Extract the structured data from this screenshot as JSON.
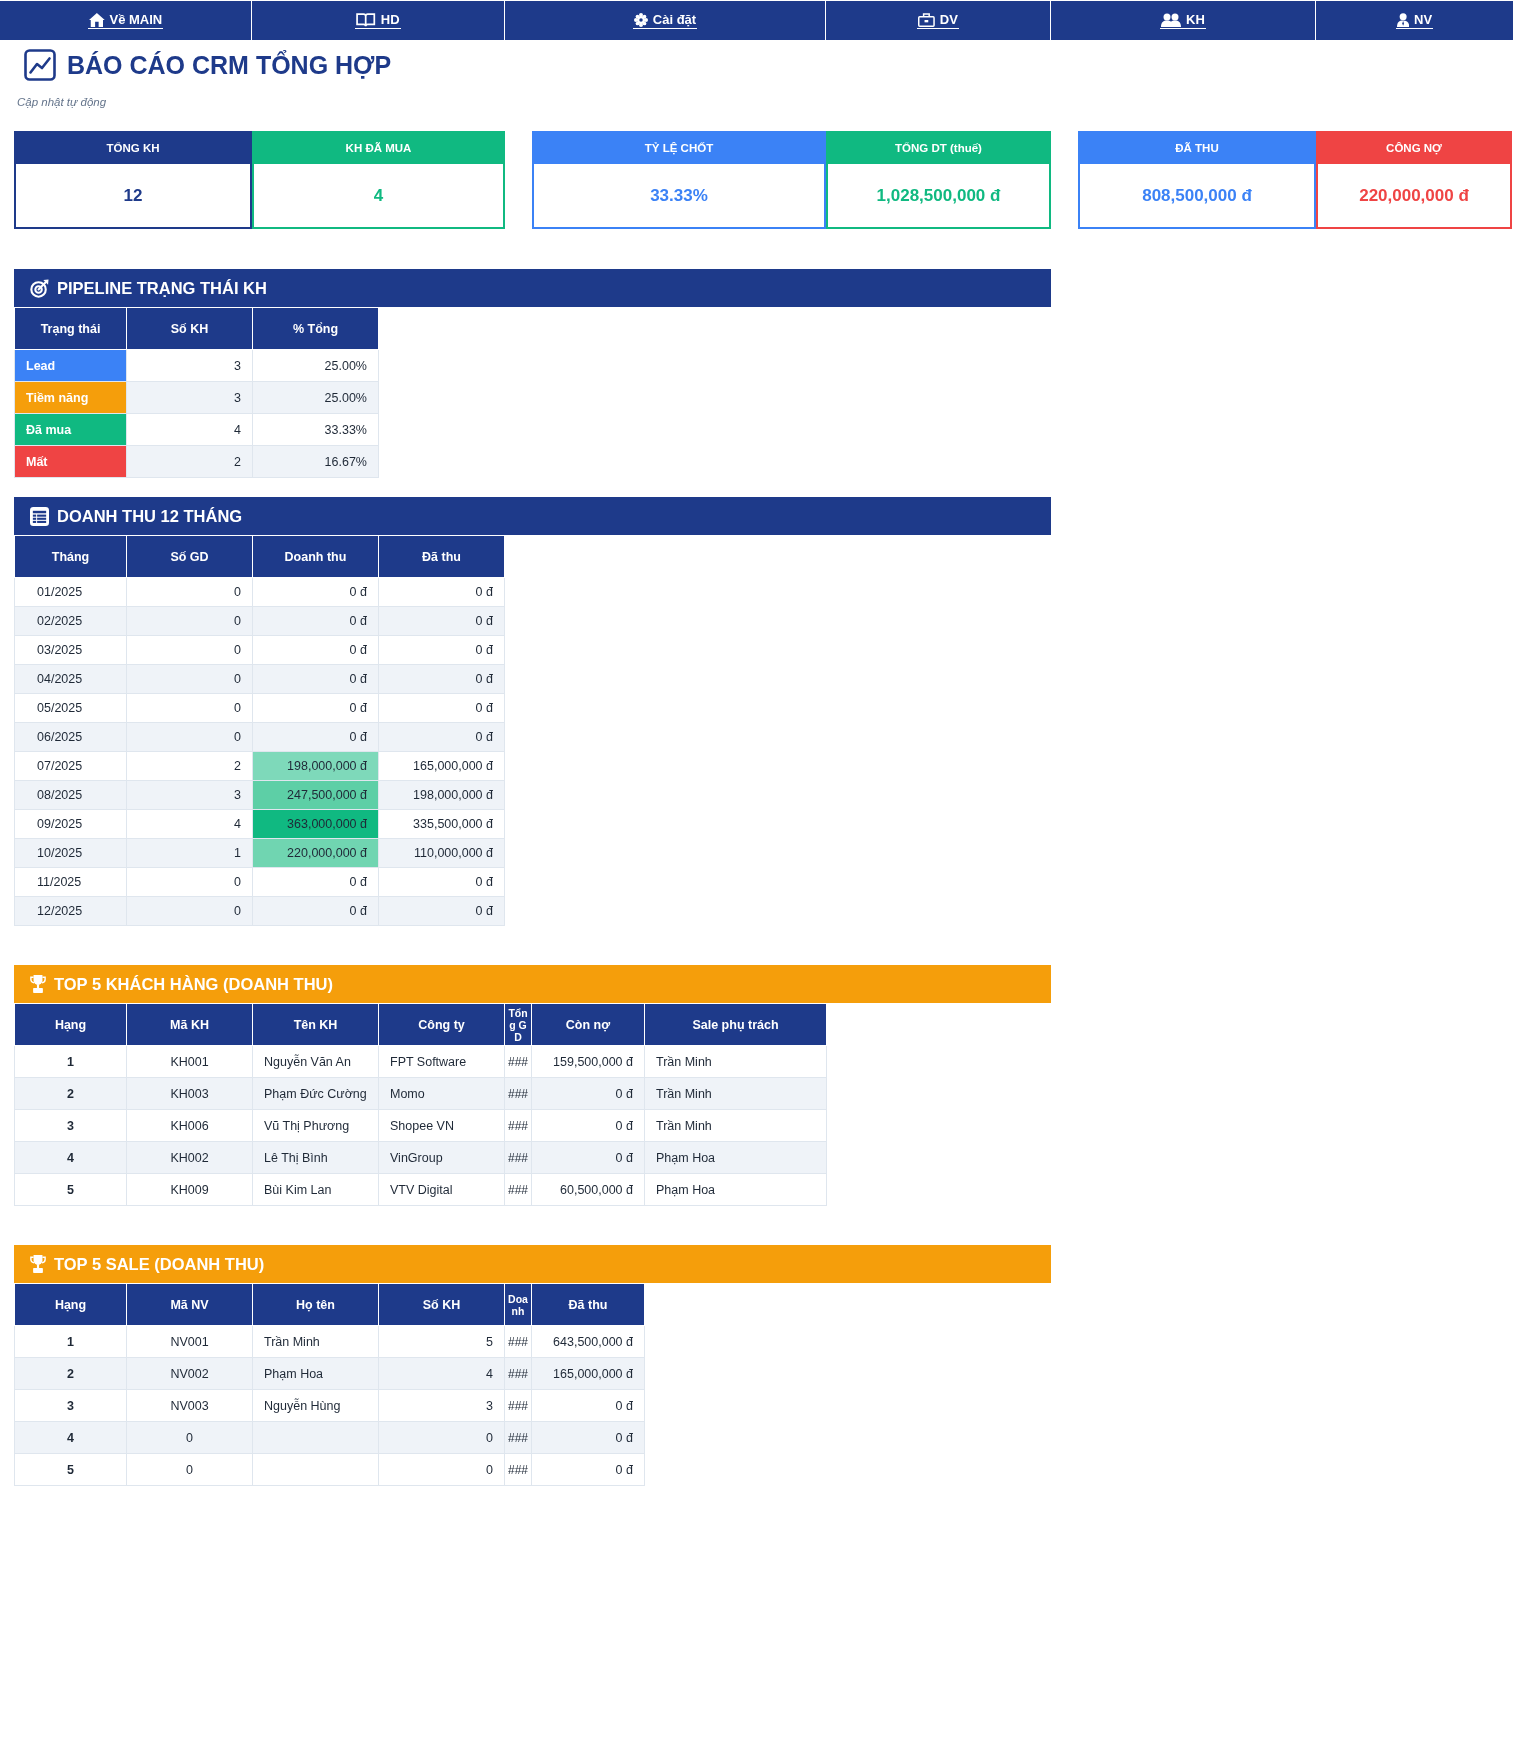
{
  "nav": [
    {
      "label": "Về MAIN"
    },
    {
      "label": "HD"
    },
    {
      "label": "Cài đặt"
    },
    {
      "label": "DV"
    },
    {
      "label": "KH"
    },
    {
      "label": "NV"
    }
  ],
  "title": "BÁO CÁO CRM TỔNG HỢP",
  "subtitle": "Cập nhật tự động",
  "kpi_groups": [
    {
      "cards": [
        {
          "label": "TỔNG KH",
          "value": "12",
          "color": "#1e3a8a"
        },
        {
          "label": "KH ĐÃ MUA",
          "value": "4",
          "color": "#10b981"
        }
      ]
    },
    {
      "cards": [
        {
          "label": "TỶ LỆ CHỐT",
          "value": "33.33%",
          "color": "#3b82f6"
        },
        {
          "label": "TỔNG DT (thuế)",
          "value": "1,028,500,000 đ",
          "color": "#10b981"
        }
      ]
    },
    {
      "cards": [
        {
          "label": "ĐÃ THU",
          "value": "808,500,000 đ",
          "color": "#3b82f6"
        },
        {
          "label": "CÔNG NỢ",
          "value": "220,000,000 đ",
          "color": "#ef4444"
        }
      ]
    }
  ],
  "pipeline": {
    "title": "PIPELINE TRẠNG THÁI KH",
    "columns": [
      "Trạng thái",
      "Số KH",
      "% Tổng"
    ],
    "rows": [
      {
        "status": "Lead",
        "color": "#3b82f6",
        "count": "3",
        "share": "25.00%"
      },
      {
        "status": "Tiềm năng",
        "color": "#f59e0b",
        "count": "3",
        "share": "25.00%"
      },
      {
        "status": "Đã mua",
        "color": "#10b981",
        "count": "4",
        "share": "33.33%"
      },
      {
        "status": "Mất",
        "color": "#ef4444",
        "count": "2",
        "share": "16.67%"
      }
    ]
  },
  "monthly": {
    "title": "DOANH THU 12 THÁNG",
    "columns": [
      "Tháng",
      "Số GD",
      "Doanh thu",
      "Đã thu"
    ],
    "rows": [
      {
        "month": "01/2025",
        "deals": "0",
        "revenue": "0 đ",
        "collected": "0 đ"
      },
      {
        "month": "02/2025",
        "deals": "0",
        "revenue": "0 đ",
        "collected": "0 đ"
      },
      {
        "month": "03/2025",
        "deals": "0",
        "revenue": "0 đ",
        "collected": "0 đ"
      },
      {
        "month": "04/2025",
        "deals": "0",
        "revenue": "0 đ",
        "collected": "0 đ"
      },
      {
        "month": "05/2025",
        "deals": "0",
        "revenue": "0 đ",
        "collected": "0 đ"
      },
      {
        "month": "06/2025",
        "deals": "0",
        "revenue": "0 đ",
        "collected": "0 đ"
      },
      {
        "month": "07/2025",
        "deals": "2",
        "revenue": "198,000,000 đ",
        "collected": "165,000,000 đ",
        "color": "#7ed9ba"
      },
      {
        "month": "08/2025",
        "deals": "3",
        "revenue": "247,500,000 đ",
        "collected": "198,000,000 đ",
        "color": "#5dcfa6"
      },
      {
        "month": "09/2025",
        "deals": "4",
        "revenue": "363,000,000 đ",
        "collected": "335,500,000 đ",
        "color": "#10b981"
      },
      {
        "month": "10/2025",
        "deals": "1",
        "revenue": "220,000,000 đ",
        "collected": "110,000,000 đ",
        "color": "#70d5b1"
      },
      {
        "month": "11/2025",
        "deals": "0",
        "revenue": "0 đ",
        "collected": "0 đ"
      },
      {
        "month": "12/2025",
        "deals": "0",
        "revenue": "0 đ",
        "collected": "0 đ"
      }
    ]
  },
  "top_customers": {
    "title": "TOP 5 KHÁCH HÀNG (DOANH THU)",
    "columns": [
      "Hạng",
      "Mã KH",
      "Tên KH",
      "Công ty",
      "Tổng GD",
      "Còn nợ",
      "Sale phụ trách"
    ],
    "rows": [
      {
        "rank": "1",
        "code": "KH001",
        "name": "Nguyễn Văn An",
        "company": "FPT Software",
        "total": "###",
        "debt": "159,500,000 đ",
        "sales_rep": "Trần Minh"
      },
      {
        "rank": "2",
        "code": "KH003",
        "name": "Phạm Đức Cường",
        "company": "Momo",
        "total": "###",
        "debt": "0 đ",
        "sales_rep": "Trần Minh"
      },
      {
        "rank": "3",
        "code": "KH006",
        "name": "Vũ Thị Phương",
        "company": "Shopee VN",
        "total": "###",
        "debt": "0 đ",
        "sales_rep": "Trần Minh"
      },
      {
        "rank": "4",
        "code": "KH002",
        "name": "Lê Thị Bình",
        "company": "VinGroup",
        "total": "###",
        "debt": "0 đ",
        "sales_rep": "Phạm Hoa"
      },
      {
        "rank": "5",
        "code": "KH009",
        "name": "Bùi Kim Lan",
        "company": "VTV Digital",
        "total": "###",
        "debt": "60,500,000 đ",
        "sales_rep": "Phạm Hoa"
      }
    ]
  },
  "top_sales": {
    "title": "TOP 5 SALE (DOANH THU)",
    "columns": [
      "Hạng",
      "Mã NV",
      "Họ tên",
      "Số KH",
      "Doanh",
      "Đã thu"
    ],
    "rows": [
      {
        "rank": "1",
        "code": "NV001",
        "name": "Trần Minh",
        "customers": "5",
        "revenue": "###",
        "collected": "643,500,000 đ"
      },
      {
        "rank": "2",
        "code": "NV002",
        "name": "Phạm Hoa",
        "customers": "4",
        "revenue": "###",
        "collected": "165,000,000 đ"
      },
      {
        "rank": "3",
        "code": "NV003",
        "name": "Nguyễn Hùng",
        "customers": "3",
        "revenue": "###",
        "collected": "0 đ"
      },
      {
        "rank": "4",
        "code": "0",
        "customers": "0",
        "revenue": "###",
        "collected": "0 đ"
      },
      {
        "rank": "5",
        "code": "0",
        "customers": "0",
        "revenue": "###",
        "collected": "0 đ"
      }
    ]
  }
}
